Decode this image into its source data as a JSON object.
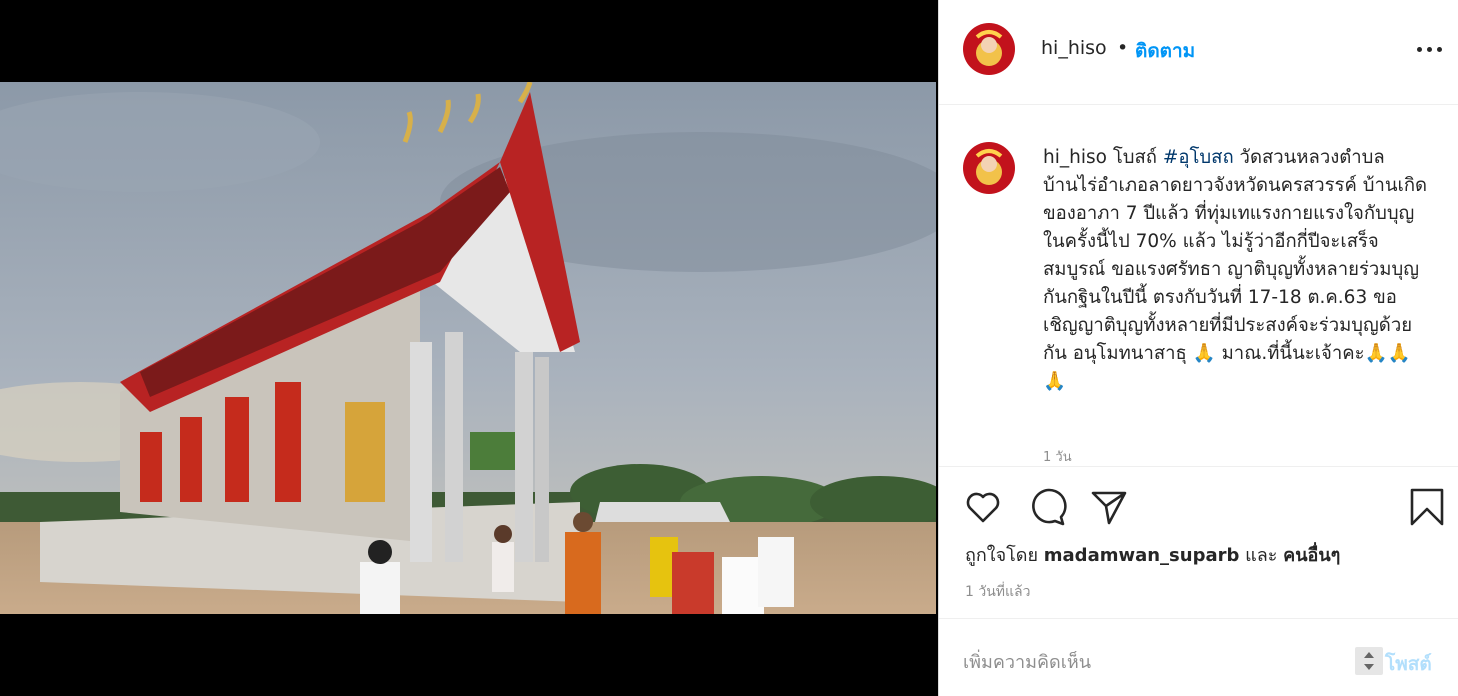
{
  "header": {
    "username": "hi_hiso",
    "separator": "•",
    "follow_label": "ติดตาม"
  },
  "caption": {
    "username": "hi_hiso",
    "before_tag": " โบสถ์ ",
    "hashtag": "#อุโบสถ",
    "after_tag": " วัดสวนหลวงตำบลบ้านไร่อำเภอลาดยาวจังหวัดนครสวรรค์ บ้านเกิดของอาภา 7 ปีแล้ว ที่ทุ่มเทแรงกายแรงใจกับบุญในครั้งนี้ไป 70% แล้ว ไม่รู้ว่าอีกกี่ปีจะเสร็จสมบูรณ์ ขอแรงศรัทธา ญาติบุญทั้งหลายร่วมบุญกันกฐินในปีนี้ ตรงกับวันที่ 17-18 ต.ค.63 ขอเชิญญาติบุญทั้งหลายที่มีประสงค์จะร่วมบุญด้วยกัน อนุโมทนาสาธุ 🙏 มาณ.ที่นี้นะเจ้าคะ🙏🙏🙏",
    "time": "1 วัน"
  },
  "likes": {
    "prefix": "ถูกใจโดย",
    "user": "madamwan_suparb",
    "joiner": "และ",
    "others": "คนอื่นๆ"
  },
  "timestamp": "1 วันที่แล้ว",
  "comment_box": {
    "placeholder": "เพิ่มความคิดเห็น",
    "post_label": "โพสต์"
  },
  "icons": {
    "like": "heart-icon",
    "comment": "comment-bubble-icon",
    "share": "paper-plane-icon",
    "save": "bookmark-icon",
    "more": "ellipsis-icon"
  },
  "colors": {
    "link_blue": "#0095f6",
    "hashtag": "#00376b",
    "post_disabled": "#b2dffc",
    "text": "#262626",
    "muted": "#8e8e8e"
  }
}
